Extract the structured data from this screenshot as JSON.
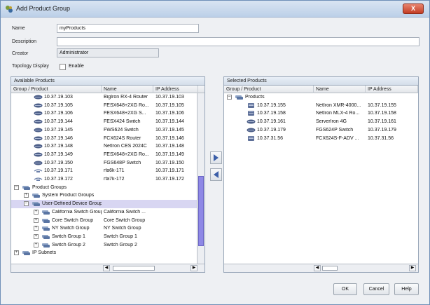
{
  "window": {
    "title": "Add Product Group",
    "close_label": "X"
  },
  "form": {
    "name_label": "Name",
    "name_value": "myProducts",
    "description_label": "Description",
    "description_value": "",
    "creator_label": "Creator",
    "creator_value": "Administrator",
    "topology_label": "Topology Display",
    "enable_label": "Enable",
    "enable_checked": false
  },
  "available": {
    "title": "Available Products",
    "columns": [
      "Group / Product",
      "Name",
      "IP Address"
    ],
    "rows": [
      {
        "label": "10.37.19.103",
        "name": "BigIron RX-4 Router",
        "ip": "10.37.19.103",
        "type": "device"
      },
      {
        "label": "10.37.19.105",
        "name": "FESX648+2XG Ro...",
        "ip": "10.37.19.105",
        "type": "device"
      },
      {
        "label": "10.37.19.106",
        "name": "FESX648+2XG S...",
        "ip": "10.37.19.106",
        "type": "device"
      },
      {
        "label": "10.37.19.144",
        "name": "FESX424 Switch",
        "ip": "10.37.19.144",
        "type": "device"
      },
      {
        "label": "10.37.19.145",
        "name": "FWS624 Switch",
        "ip": "10.37.19.145",
        "type": "device"
      },
      {
        "label": "10.37.19.146",
        "name": "FCX624S Router",
        "ip": "10.37.19.146",
        "type": "device"
      },
      {
        "label": "10.37.19.148",
        "name": "NetIron CES 2024C",
        "ip": "10.37.19.148",
        "type": "device"
      },
      {
        "label": "10.37.19.149",
        "name": "FESX648+2XG Ro...",
        "ip": "10.37.19.149",
        "type": "device"
      },
      {
        "label": "10.37.19.150",
        "name": "FGS648P Switch",
        "ip": "10.37.19.150",
        "type": "device"
      },
      {
        "label": "10.37.19.171",
        "name": "rfa6k-171",
        "ip": "10.37.19.171",
        "type": "wireless"
      },
      {
        "label": "10.37.19.172",
        "name": "rfa7k-172",
        "ip": "10.37.19.172",
        "type": "wireless"
      },
      {
        "label": "Product Groups",
        "name": "",
        "ip": "",
        "type": "group",
        "expander": "-"
      },
      {
        "label": "System Product Groups",
        "name": "",
        "ip": "",
        "type": "group",
        "expander": "+"
      },
      {
        "label": "User-Defined Device Groups",
        "name": "",
        "ip": "",
        "type": "group",
        "expander": "-"
      },
      {
        "label": "California Switch Group",
        "name": "California Switch ...",
        "ip": "",
        "type": "group",
        "expander": "+"
      },
      {
        "label": "Core Switch Group",
        "name": "Core Switch Group",
        "ip": "",
        "type": "group",
        "expander": "+"
      },
      {
        "label": "NY Switch Group",
        "name": "NY Switch Group",
        "ip": "",
        "type": "group",
        "expander": "+"
      },
      {
        "label": "Switch Group 1",
        "name": "Switch Group 1",
        "ip": "",
        "type": "group",
        "expander": "+"
      },
      {
        "label": "Switch Group 2",
        "name": "Switch Group 2",
        "ip": "",
        "type": "group",
        "expander": "+"
      },
      {
        "label": "IP Subnets",
        "name": "",
        "ip": "",
        "type": "group",
        "expander": "+"
      }
    ]
  },
  "selected": {
    "title": "Selected Products",
    "columns": [
      "Group / Product",
      "Name",
      "IP Address"
    ],
    "rows": [
      {
        "label": "Products",
        "name": "",
        "ip": "",
        "type": "group",
        "expander": "-"
      },
      {
        "label": "10.37.19.155",
        "name": "NetIron XMR-4000...",
        "ip": "10.37.19.155",
        "type": "router"
      },
      {
        "label": "10.37.19.158",
        "name": "NetIron MLX-4 Ro...",
        "ip": "10.37.19.158",
        "type": "router"
      },
      {
        "label": "10.37.19.161",
        "name": "ServerIron 4G",
        "ip": "10.37.19.161",
        "type": "device"
      },
      {
        "label": "10.37.19.179",
        "name": "FGS624P Switch",
        "ip": "10.37.19.179",
        "type": "device"
      },
      {
        "label": "10.37.31.56",
        "name": "FCX624S-F-ADV ...",
        "ip": "10.37.31.56",
        "type": "router"
      }
    ]
  },
  "buttons": {
    "ok": "OK",
    "cancel": "Cancel",
    "help": "Help"
  },
  "colors": {
    "selection": "#d8d6f2",
    "scroll_thumb": "#8e88e6",
    "title_bar": "#bcd0e8"
  }
}
